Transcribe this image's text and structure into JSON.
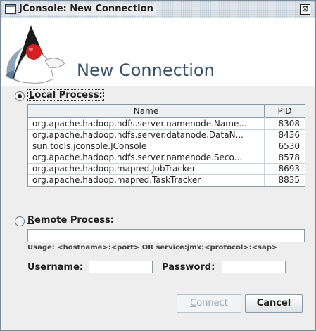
{
  "window": {
    "title": "JConsole: New Connection",
    "close_glyph": "⊠"
  },
  "header": {
    "title": "New Connection",
    "logo_icon": "java-duke-logo-icon"
  },
  "local": {
    "label_mnemonic": "L",
    "label_rest": "ocal Process:",
    "selected": true,
    "columns": {
      "name": "Name",
      "pid": "PID"
    },
    "rows": [
      {
        "name": "org.apache.hadoop.hdfs.server.namenode.Name...",
        "pid": "8308"
      },
      {
        "name": "org.apache.hadoop.hdfs.server.datanode.DataN...",
        "pid": "8436"
      },
      {
        "name": "sun.tools.jconsole.JConsole",
        "pid": "6530"
      },
      {
        "name": "org.apache.hadoop.hdfs.server.namenode.Seco...",
        "pid": "8578"
      },
      {
        "name": "org.apache.hadoop.mapred.JobTracker",
        "pid": "8693"
      },
      {
        "name": "org.apache.hadoop.mapred.TaskTracker",
        "pid": "8835"
      }
    ]
  },
  "remote": {
    "label_mnemonic": "R",
    "label_rest": "emote Process:",
    "selected": false,
    "value": "",
    "usage": "Usage: <hostname>:<port> OR service:jmx:<protocol>:<sap>"
  },
  "credentials": {
    "username_mnemonic": "U",
    "username_rest": "sername:",
    "username_value": "",
    "password_mnemonic": "P",
    "password_rest": "assword:",
    "password_value": ""
  },
  "buttons": {
    "connect_mnemonic": "C",
    "connect_rest": "onnect",
    "cancel": "Cancel"
  }
}
